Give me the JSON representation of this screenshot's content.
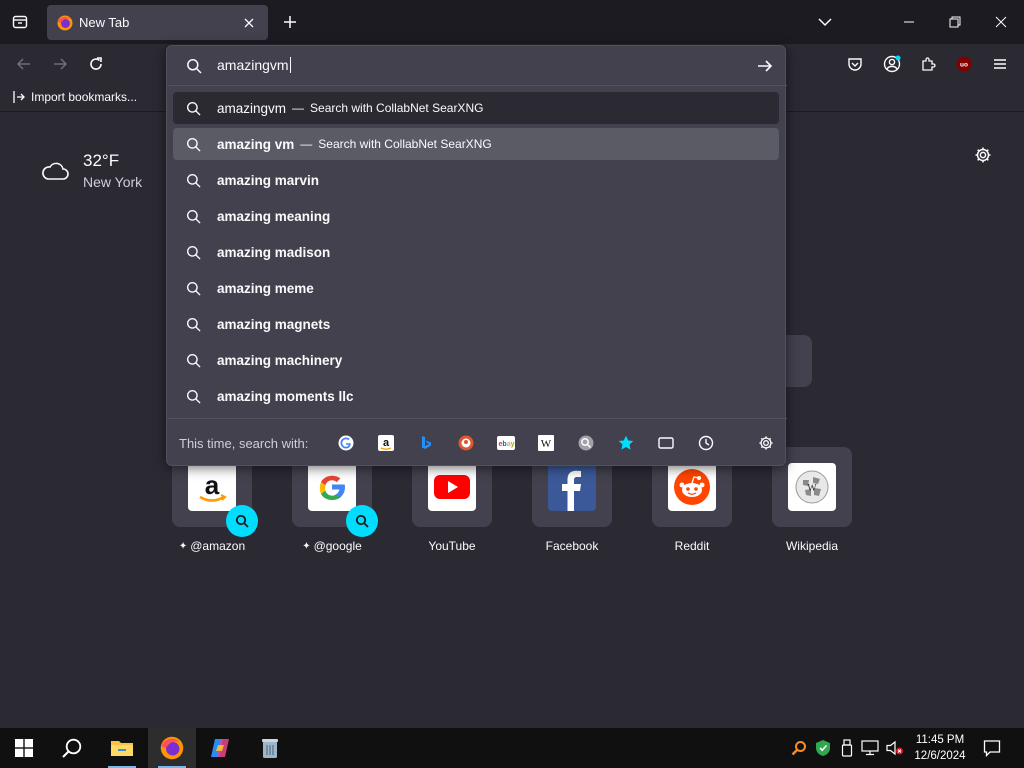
{
  "colors": {
    "toolbar": "#2b2a33",
    "titlebar": "#1c1b22",
    "popup": "#42414d",
    "selected_row": "#5b5b66",
    "accent": "#00ddff"
  },
  "tab": {
    "title": "New Tab",
    "icon": "firefox-icon"
  },
  "bookmarks": {
    "import_label": "Import bookmarks..."
  },
  "urlbar": {
    "value": "amazingvm",
    "results": [
      {
        "query": "amazingvm",
        "action": "Search with CollabNet SearXNG",
        "bold": false,
        "state": "first"
      },
      {
        "query": "amazing vm",
        "action": "Search with CollabNet SearXNG",
        "bold": true,
        "state": "selected"
      },
      {
        "query": "amazing marvin",
        "action": "",
        "bold": true,
        "state": ""
      },
      {
        "query": "amazing meaning",
        "action": "",
        "bold": true,
        "state": ""
      },
      {
        "query": "amazing madison",
        "action": "",
        "bold": true,
        "state": ""
      },
      {
        "query": "amazing meme",
        "action": "",
        "bold": true,
        "state": ""
      },
      {
        "query": "amazing magnets",
        "action": "",
        "bold": true,
        "state": ""
      },
      {
        "query": "amazing machinery",
        "action": "",
        "bold": true,
        "state": ""
      },
      {
        "query": "amazing moments llc",
        "action": "",
        "bold": true,
        "state": ""
      }
    ],
    "oneoff_label": "This time, search with:",
    "engines": [
      "google-icon",
      "amazon-icon",
      "bing-icon",
      "duckduckgo-icon",
      "ebay-icon",
      "wikipedia-icon",
      "searxng-icon",
      "bookmarks-star-icon",
      "tabs-icon",
      "history-icon",
      "search-settings-icon"
    ]
  },
  "weather": {
    "temp": "32°F",
    "location": "New York",
    "icon": "cloud-icon"
  },
  "shortcuts": [
    {
      "label": "@amazon",
      "pinned": true,
      "icon": "amazon-logo",
      "search_badge": true
    },
    {
      "label": "@google",
      "pinned": true,
      "icon": "google-logo",
      "search_badge": true
    },
    {
      "label": "YouTube",
      "pinned": false,
      "icon": "youtube-logo",
      "search_badge": false
    },
    {
      "label": "Facebook",
      "pinned": false,
      "icon": "facebook-logo",
      "search_badge": false
    },
    {
      "label": "Reddit",
      "pinned": false,
      "icon": "reddit-logo",
      "search_badge": false
    },
    {
      "label": "Wikipedia",
      "pinned": false,
      "icon": "wikipedia-logo",
      "search_badge": false
    }
  ],
  "taskbar": {
    "time": "11:45 PM",
    "date": "12/6/2024",
    "apps": [
      "windows-start-icon",
      "search-icon",
      "file-explorer-icon",
      "firefox-icon",
      "copilot-icon",
      "recycle-bin-icon"
    ]
  }
}
